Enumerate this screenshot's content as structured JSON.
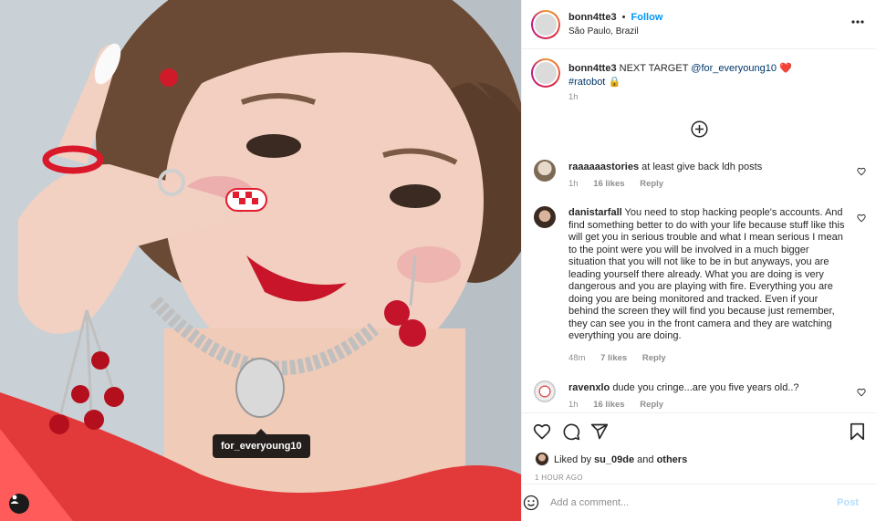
{
  "post": {
    "username": "bonn4tte3",
    "follow_label": "Follow",
    "separator": "•",
    "location": "São Paulo, Brazil",
    "photo_tag": "for_everyoung10"
  },
  "caption": {
    "username": "bonn4tte3",
    "text": "NEXT TARGET",
    "mention": "@for_everyoung10",
    "heart_emoji": "❤️",
    "hashtag": "#ratobot",
    "lock_emoji": "🔒",
    "time": "1h"
  },
  "comments": [
    {
      "username": "raaaaaastories",
      "text": "at least give back ldh posts",
      "time": "1h",
      "likes": "16 likes",
      "reply": "Reply"
    },
    {
      "username": "danistarfall",
      "text": "You need to stop hacking people's accounts. And find something better to do with your life because stuff like this will get you in serious trouble and what I mean serious I mean to the point were you will be involved in a much bigger situation that you will not like to be in but anyways, you are leading yourself there already. What you are doing is very dangerous and you are playing with fire. Everything you are doing you are being monitored and tracked. Even if your behind the screen they will find you because just remember, they can see you in the front camera and they are watching everything you are doing.",
      "time": "48m",
      "likes": "7 likes",
      "reply": "Reply"
    },
    {
      "username": "ravenxlo",
      "text": "dude you cringe...are you five years old..?",
      "time": "1h",
      "likes": "16 likes",
      "reply": "Reply"
    }
  ],
  "likes": {
    "prefix": "Liked by",
    "user": "su_09de",
    "and": "and",
    "others": "others"
  },
  "timestamp": "1 HOUR AGO",
  "add_comment": {
    "placeholder": "Add a comment...",
    "post_label": "Post"
  },
  "colors": {
    "link": "#00376b",
    "follow": "#0095f6",
    "post_disabled": "#b2dffc",
    "muted": "#8e8e8e"
  },
  "icons": {
    "more": "more-icon",
    "load_more": "plus-circle-icon",
    "like": "heart-icon",
    "comment": "comment-icon",
    "share": "send-icon",
    "save": "bookmark-icon",
    "emoji": "emoji-icon",
    "user_tag": "person-icon"
  }
}
